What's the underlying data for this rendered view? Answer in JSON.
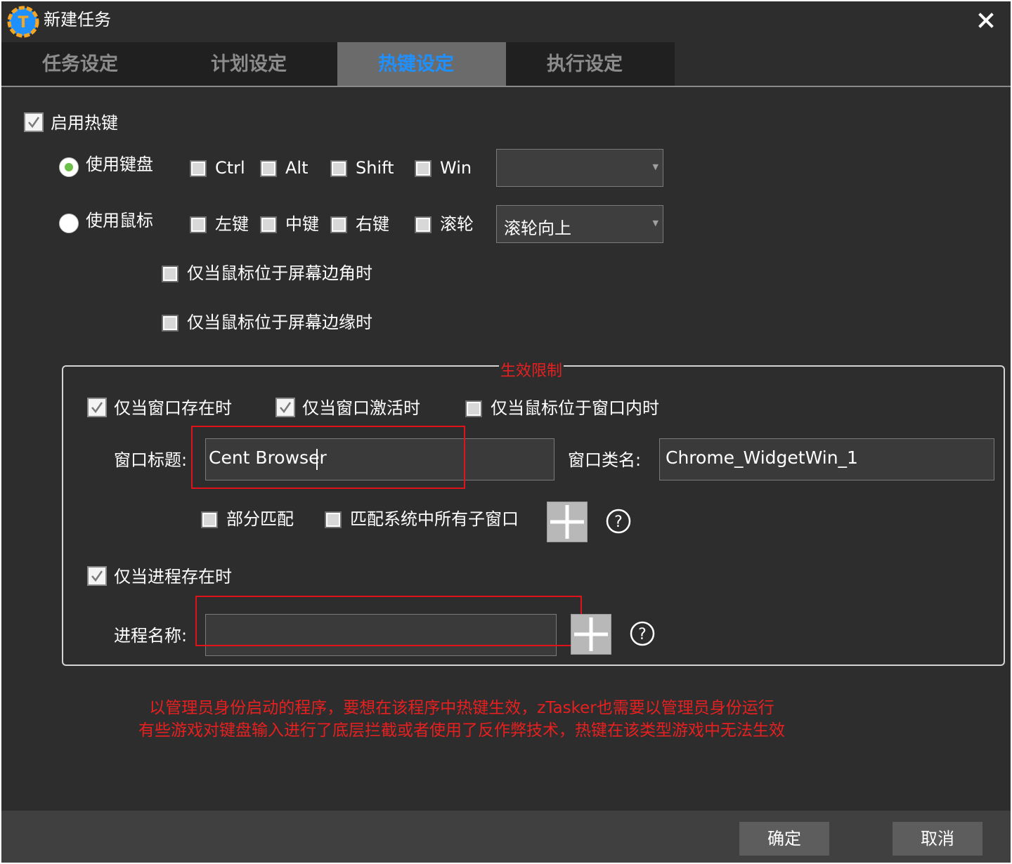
{
  "window": {
    "title": "新建任务"
  },
  "tabs": [
    {
      "label": "任务设定",
      "active": false
    },
    {
      "label": "计划设定",
      "active": false
    },
    {
      "label": "热键设定",
      "active": true
    },
    {
      "label": "执行设定",
      "active": false
    }
  ],
  "hotkey": {
    "enable_label": "启用热键",
    "enable_checked": true,
    "keyboard": {
      "label": "使用键盘",
      "selected": true,
      "modifiers": [
        "Ctrl",
        "Alt",
        "Shift",
        "Win"
      ],
      "key_value": ""
    },
    "mouse": {
      "label": "使用鼠标",
      "selected": false,
      "buttons": [
        "左键",
        "中键",
        "右键",
        "滚轮"
      ],
      "action_value": "滚轮向上",
      "corner_label": "仅当鼠标位于屏幕边角时",
      "edge_label": "仅当鼠标位于屏幕边缘时"
    }
  },
  "limits": {
    "legend": "生效限制",
    "window_exists_label": "仅当窗口存在时",
    "window_active_label": "仅当窗口激活时",
    "mouse_in_window_label": "仅当鼠标位于窗口内时",
    "window_title_label": "窗口标题:",
    "window_title_value": "Cent Browser",
    "window_class_label": "窗口类名:",
    "window_class_value": "Chrome_WidgetWin_1",
    "partial_match_label": "部分匹配",
    "match_child_label": "匹配系统中所有子窗口",
    "process_exists_label": "仅当进程存在时",
    "process_name_label": "进程名称:",
    "process_name_value": ""
  },
  "notes": [
    "以管理员身份启动的程序，要想在该程序中热键生效，zTasker也需要以管理员身份运行",
    "有些游戏对键盘输入进行了底层拦截或者使用了反作弊技术，热键在该类型游戏中无法生效"
  ],
  "footer": {
    "ok_label": "确定",
    "cancel_label": "取消"
  },
  "colors": {
    "accent": "#1e90ff",
    "warning": "#e62020",
    "radio_on": "#6cc04a"
  }
}
